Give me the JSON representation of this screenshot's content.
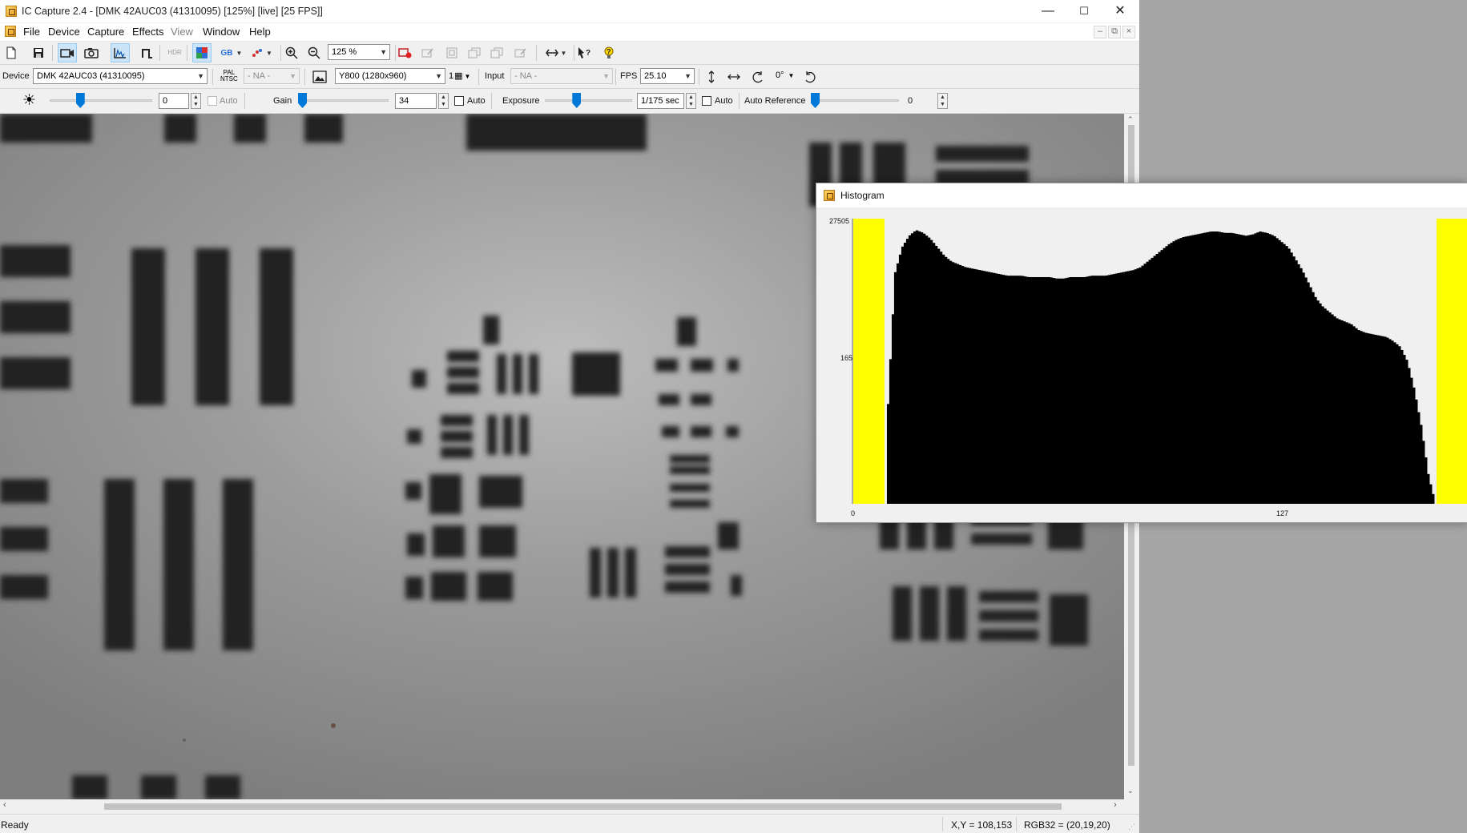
{
  "window": {
    "title": "IC Capture 2.4 - [DMK 42AUC03 (41310095) [125%]  [live]  [25 FPS]]",
    "controls": {
      "minimize": "—",
      "maximize": "☐",
      "close": "✕"
    }
  },
  "menu": {
    "items": [
      "File",
      "Device",
      "Capture",
      "Effects",
      "View",
      "Window",
      "Help"
    ],
    "mdi_controls": [
      "–",
      "⧉",
      "×"
    ]
  },
  "toolbar": {
    "zoom_value": "125 %",
    "rotation": "0°",
    "icons": [
      "new-icon",
      "save-icon",
      "live-video-icon",
      "snapshot-icon",
      "histogram-icon",
      "trigger-icon",
      "hdr-icon",
      "color-format-icon",
      "rgb-icon",
      "color-dots-icon",
      "zoom-in-icon",
      "zoom-out-icon",
      "record-icon",
      "overlay-icons",
      "display-mode-icon",
      "context-help-icon",
      "help-icon"
    ],
    "gb_label": "GB",
    "hdr_label": "HDR"
  },
  "device_bar": {
    "device_label": "Device",
    "device_value": "DMK 42AUC03 (41310095)",
    "pal_label": "PAL",
    "ntsc_label": "NTSC",
    "video_norm_value": "- NA -",
    "format_value": "Y800 (1280x960)",
    "binning_value": "1",
    "input_label": "Input",
    "input_value": "- NA -",
    "fps_label": "FPS",
    "fps_value": "25.10",
    "rotation_value": "0°"
  },
  "properties_bar": {
    "brightness_value": "0",
    "brightness_auto_label": "Auto",
    "gain_label": "Gain",
    "gain_value": "34",
    "gain_auto_label": "Auto",
    "exposure_label": "Exposure",
    "exposure_value": "1/175 sec",
    "exposure_auto_label": "Auto",
    "auto_reference_label": "Auto Reference",
    "auto_reference_value": "0",
    "brightness_level": 0.28,
    "gain_level": 0.0,
    "exposure_level": 0.35,
    "auto_reference_level": 0.0
  },
  "status": {
    "left": "Ready",
    "coords": "X,Y = 108,153",
    "pixel": "RGB32 = (20,19,20)"
  },
  "histogram": {
    "title": "Histogram",
    "y_ticks": [
      "27505",
      "165"
    ],
    "x_ticks": [
      "0",
      "127"
    ],
    "colors": {
      "clip_marker": "#ffff00",
      "bars": "#000000",
      "background": "#f0f0f0"
    }
  },
  "chart_data": {
    "type": "bar",
    "title": "Histogram",
    "xlabel": "",
    "ylabel": "",
    "y_ticks": [
      "27505",
      "165"
    ],
    "x_ticks": [
      "0",
      "127"
    ],
    "clip_markers": {
      "low_bins": [
        0,
        13
      ],
      "high_bins": [
        243,
        255
      ],
      "color": "#ffff00"
    },
    "values": [
      0.35,
      0.81,
      0.9,
      0.94,
      0.96,
      0.95,
      0.93,
      0.9,
      0.87,
      0.85,
      0.84,
      0.83,
      0.825,
      0.82,
      0.815,
      0.81,
      0.805,
      0.8,
      0.8,
      0.8,
      0.795,
      0.795,
      0.795,
      0.795,
      0.79,
      0.79,
      0.795,
      0.795,
      0.795,
      0.8,
      0.8,
      0.8,
      0.805,
      0.81,
      0.815,
      0.82,
      0.83,
      0.85,
      0.87,
      0.89,
      0.91,
      0.925,
      0.935,
      0.94,
      0.945,
      0.95,
      0.955,
      0.955,
      0.95,
      0.95,
      0.945,
      0.94,
      0.945,
      0.955,
      0.95,
      0.94,
      0.92,
      0.9,
      0.86,
      0.82,
      0.77,
      0.72,
      0.69,
      0.67,
      0.65,
      0.64,
      0.63,
      0.61,
      0.6,
      0.595,
      0.59,
      0.585,
      0.57,
      0.55,
      0.5,
      0.4,
      0.27,
      0.1,
      0.0
    ]
  }
}
